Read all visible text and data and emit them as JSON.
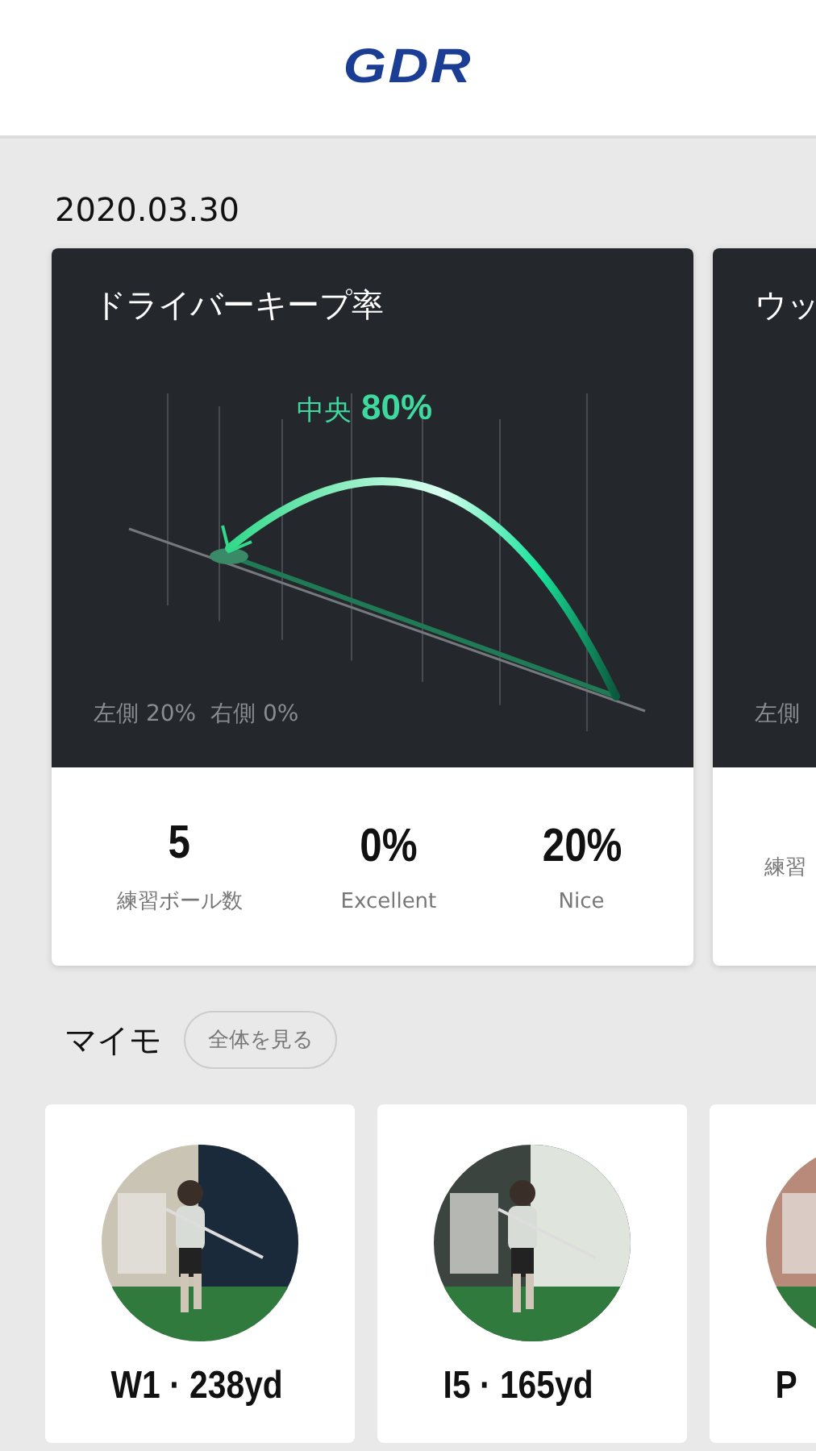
{
  "header": {
    "logo": "GDR"
  },
  "date": "2020.03.30",
  "stat_cards": [
    {
      "title": "ドライバーキープ率",
      "center_label": "中央",
      "center_value": "80%",
      "sides": [
        "左側 20%",
        "右側 0%"
      ],
      "stats": [
        {
          "value": "5",
          "label": "練習ボール数"
        },
        {
          "value": "0%",
          "label": "Excellent"
        },
        {
          "value": "20%",
          "label": "Nice"
        }
      ]
    },
    {
      "title": "ウッ",
      "sides": [
        "左側"
      ],
      "stats": [
        {
          "label": "練習"
        }
      ]
    }
  ],
  "memo": {
    "title": "マイモ",
    "view_all": "全体を見る",
    "items": [
      {
        "caption": "W1 · 238yd"
      },
      {
        "caption": "I5 · 165yd"
      },
      {
        "caption": "P"
      }
    ]
  }
}
